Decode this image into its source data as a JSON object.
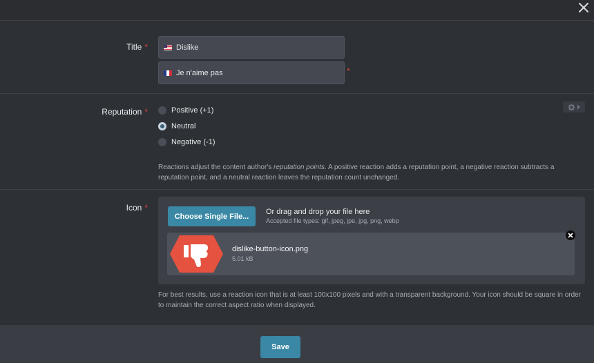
{
  "icons": {
    "close": "close-icon",
    "gear": "gear-icon",
    "chevron": "chevron-right-icon",
    "remove": "close-icon",
    "thumb": "thumbs-down-icon"
  },
  "colors": {
    "accent": "#3a88a5",
    "required": "#d7443d",
    "thumb_bg": "#e5523f"
  },
  "title_field": {
    "label": "Title",
    "required_mark": "*",
    "en_value": "Dislike",
    "fr_value": "Je n'aime pas"
  },
  "reputation": {
    "label": "Reputation",
    "required_mark": "*",
    "options": [
      {
        "label": "Positive (+1)",
        "checked": false
      },
      {
        "label": "Neutral",
        "checked": true
      },
      {
        "label": "Negative (-1)",
        "checked": false
      }
    ],
    "help_pre": "Reactions adjust the content author's ",
    "help_em": "reputation points",
    "help_post": ". A positive reaction adds a reputation point, a negative reaction subtracts a reputation point, and a neutral reaction leaves the reputation count unchanged."
  },
  "icon_field": {
    "label": "Icon",
    "required_mark": "*",
    "choose_button": "Choose Single File...",
    "drop_title": "Or drag and drop your file here",
    "drop_types": "Accepted file types: gif, jpeg, jpe, jpg, png, webp",
    "file_name": "dislike-button-icon.png",
    "file_size": "5.01 kB",
    "help": "For best results, use a reaction icon that is at least 100x100 pixels and with a transparent background. Your icon should be square in order to maintain the correct aspect ratio when displayed."
  },
  "footer": {
    "save_label": "Save"
  }
}
